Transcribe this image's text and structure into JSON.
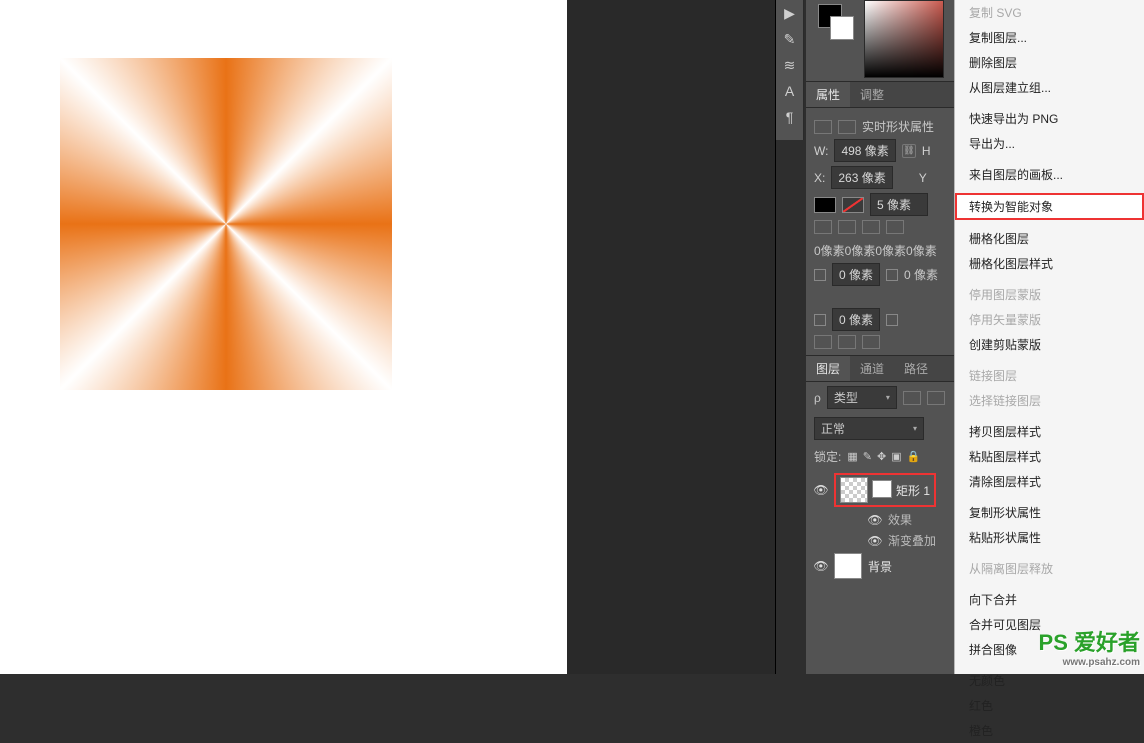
{
  "canvas": {
    "shape_fill": "conic-orange"
  },
  "panels": {
    "props_tabs": {
      "active": "属性",
      "other": "调整"
    },
    "shape_title": "实时形状属性",
    "w_label": "W:",
    "w_value": "498 像素",
    "x_label": "X:",
    "x_value": "263 像素",
    "h_label": "H",
    "y_label": "Y",
    "stroke_value": "5 像素",
    "corners_line": "0像素0像素0像素0像素",
    "px0": "0 像素",
    "layers_tabs": {
      "a": "图层",
      "b": "通道",
      "c": "路径"
    },
    "filter_label": "类型",
    "blend_mode": "正常",
    "lock_label": "锁定:",
    "layer1_name": "矩形 1",
    "fx_label": "效果",
    "fx_item": "渐变叠加",
    "bg_name": "背景"
  },
  "ctx": {
    "copy_svg": "复制 SVG",
    "dup_layer": "复制图层...",
    "del_layer": "删除图层",
    "group_from": "从图层建立组...",
    "quick_png": "快速导出为 PNG",
    "export_as": "导出为...",
    "artboard_from": "来自图层的画板...",
    "to_smart": "转换为智能对象",
    "rasterize": "栅格化图层",
    "rasterize_style": "栅格化图层样式",
    "disable_mask": "停用图层蒙版",
    "disable_vmask": "停用矢量蒙版",
    "create_clip": "创建剪贴蒙版",
    "link_layer": "链接图层",
    "select_linked": "选择链接图层",
    "copy_style": "拷贝图层样式",
    "paste_style": "粘贴图层样式",
    "clear_style": "清除图层样式",
    "copy_shape_attr": "复制形状属性",
    "paste_shape_attr": "粘贴形状属性",
    "release_iso": "从隔离图层释放",
    "merge_down": "向下合并",
    "merge_visible": "合并可见图层",
    "flatten": "拼合图像",
    "no_color": "无颜色",
    "red": "红色",
    "orange": "橙色"
  },
  "watermark": {
    "text": "PS 爱好者",
    "url": "www.psahz.com"
  }
}
